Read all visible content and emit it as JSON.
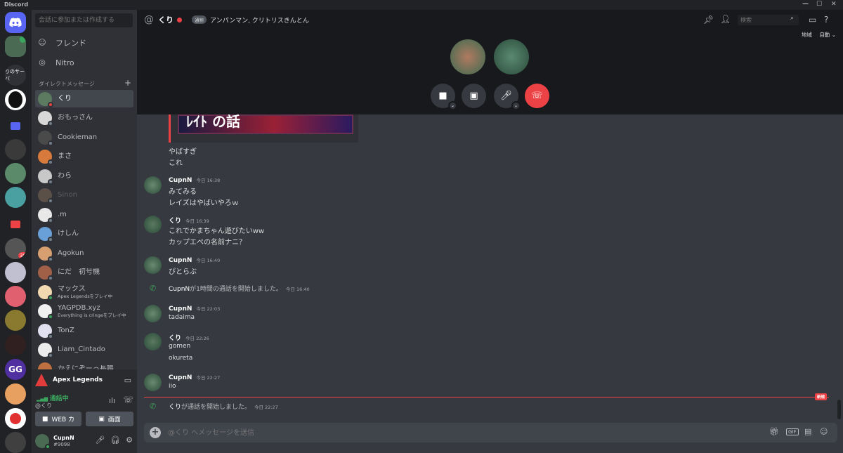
{
  "app": {
    "title": "Discord"
  },
  "window_controls": {
    "minimize": "—",
    "maximize": "☐",
    "close": "✕"
  },
  "servers": {
    "home_icon": "discord-logo-icon",
    "server_label": "りのサーバ",
    "mention_badge": "39"
  },
  "dm_sidebar": {
    "search_placeholder": "会話に参加または作成する",
    "friends": "フレンド",
    "nitro": "Nitro",
    "dm_header": "ダイレクトメッセージ",
    "add": "+",
    "items": [
      {
        "name": "くり",
        "sub": "",
        "status": "dnd",
        "color": "#5c7a60"
      },
      {
        "name": "おもっさん",
        "sub": "",
        "status": "offline",
        "color": "#d8d8d8"
      },
      {
        "name": "Cookieman",
        "sub": "",
        "status": "offline",
        "color": "#4a4a4a"
      },
      {
        "name": "まさ",
        "sub": "",
        "status": "offline",
        "color": "#d77a3c"
      },
      {
        "name": "わら",
        "sub": "",
        "status": "offline",
        "color": "#c8c8c8"
      },
      {
        "name": "Sinon",
        "sub": "",
        "status": "offline",
        "color": "#5a5048"
      },
      {
        "name": ".m",
        "sub": "",
        "status": "offline",
        "color": "#e8e8e8"
      },
      {
        "name": "けしん",
        "sub": "",
        "status": "offline",
        "color": "#6aa0d8"
      },
      {
        "name": "Agokun",
        "sub": "",
        "status": "offline",
        "color": "#d8a070"
      },
      {
        "name": "にだ　初号機",
        "sub": "",
        "status": "offline",
        "color": "#a06048"
      },
      {
        "name": "マックス",
        "sub": "Apex Legendsをプレイ中",
        "status": "online",
        "color": "#f0d8b0"
      },
      {
        "name": "YAGPDB.xyz",
        "sub": "Everything is cringeをプレイ中",
        "status": "online",
        "color": "#f0f0f0"
      },
      {
        "name": "TonZ",
        "sub": "",
        "status": "offline",
        "color": "#e0e0f0"
      },
      {
        "name": "Liam_Cintado",
        "sub": "",
        "status": "offline",
        "color": "#ececec"
      },
      {
        "name": "かえにぞーっ長鳴",
        "sub": "",
        "status": "offline",
        "color": "#c07040"
      }
    ]
  },
  "game_bar": {
    "name": "Apex Legends"
  },
  "voice_panel": {
    "status": "通話中",
    "channel": "@くり",
    "video_btn": "WEB カ",
    "screen_btn": "画面"
  },
  "user_panel": {
    "name": "CupnN",
    "tag": "#9098"
  },
  "header": {
    "at_icon": "@",
    "channel": "くり",
    "call_pill": "通称",
    "members": "アンパンマン, クリトリスきんとん",
    "search_placeholder": "検索",
    "region_label": "地域",
    "region_value": "自動"
  },
  "call_controls": [
    "camera-button",
    "screen-share-button",
    "mic-button",
    "hangup-button"
  ],
  "messages": {
    "embed_text": "ﾚｲﾄ の話",
    "m1_l1": "やばすぎ",
    "m1_l2": "これ",
    "m2_author": "CupnN",
    "m2_time": "今日 16:38",
    "m2_l1": "みてみる",
    "m2_l2": "レイズはやばいやろｗ",
    "m3_author": "くり",
    "m3_time": "今日 16:39",
    "m3_l1": "これでかまちゃん遊びたいww",
    "m3_l2": "カップエペの名前ナニ？",
    "m4_author": "CupnN",
    "m4_time": "今日 16:40",
    "m4_l1": "ぴとらぶ",
    "sys1_name": "CupnN",
    "sys1_text": "が1時間の通話を開始しました。",
    "sys1_time": "今日 16:40",
    "m5_author": "CupnN",
    "m5_time": "今日 22:03",
    "m5_l1": "tadaima",
    "m6_author": "くり",
    "m6_time": "今日 22:26",
    "m6_l1": "gomen",
    "m6_l2": "okureta",
    "m7_author": "CupnN",
    "m7_time": "今日 22:27",
    "m7_l1": "iio",
    "new_label": "新規",
    "sys2_name": "くり",
    "sys2_text": "が通話を開始しました。",
    "sys2_time": "今日 22:27"
  },
  "composer": {
    "placeholder": "@くり へメッセージを送信",
    "gif": "GIF"
  },
  "colors": {
    "accent": "#5865f2",
    "danger": "#ed4245",
    "online": "#3ba55d"
  }
}
